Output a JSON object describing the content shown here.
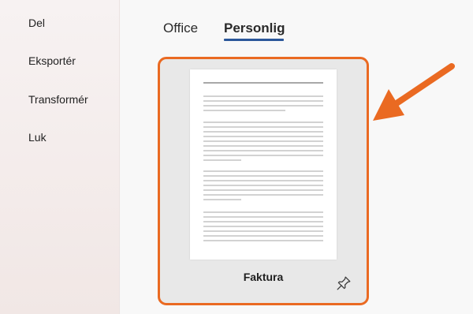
{
  "sidebar": {
    "items": [
      {
        "label": "Del"
      },
      {
        "label": "Eksportér"
      },
      {
        "label": "Transformér"
      },
      {
        "label": "Luk"
      }
    ]
  },
  "tabs": [
    {
      "label": "Office",
      "active": false
    },
    {
      "label": "Personlig",
      "active": true
    }
  ],
  "template_card": {
    "label": "Faktura",
    "highlight_color": "#ea6a22"
  },
  "icons": {
    "pin": "pin-icon",
    "arrow": "arrow-annotation"
  },
  "colors": {
    "accent_underline": "#2b579a",
    "highlight": "#ea6a22"
  }
}
